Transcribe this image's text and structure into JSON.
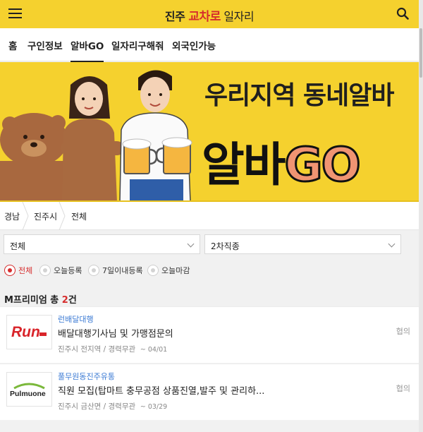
{
  "header": {
    "brand_part1": "진주 ",
    "brand_part2": "교차로",
    "brand_part3": " 일자리"
  },
  "tabs": [
    {
      "label": "홈"
    },
    {
      "label": "구인정보"
    },
    {
      "label": "알바GO",
      "active": true
    },
    {
      "label": "일자리구해줘"
    },
    {
      "label": "외국인가능"
    }
  ],
  "banner": {
    "slogan": "우리지역 동네알바",
    "big_prefix": "알바",
    "big_go": "GO"
  },
  "breadcrumb": [
    "경남",
    "진주시",
    "전체"
  ],
  "filters": {
    "category_select": "전체",
    "subcategory_select": "2차직종",
    "radios": [
      {
        "label": "전체",
        "checked": true
      },
      {
        "label": "오늘등록",
        "checked": false
      },
      {
        "label": "7일이내등록",
        "checked": false
      },
      {
        "label": "오늘마감",
        "checked": false
      }
    ]
  },
  "premium": {
    "prefix": "M프리미엄 총 ",
    "count": "2",
    "suffix": "건"
  },
  "jobs": [
    {
      "logo_text": "Run",
      "company": "런배달대행",
      "title": "배달대행기사님 및 가맹점문의",
      "location": "진주시 전지역 / 경력무관",
      "date": "~ 04/01",
      "pay": "협의"
    },
    {
      "logo_text": "Pulmuone",
      "company": "풀무원동진주유통",
      "title": "직원 모집(탑마트 충무공점 상품진열,발주 및 관리하...",
      "location": "진주시 금산면 / 경력무관",
      "date": "~ 03/29",
      "pay": "협의"
    }
  ],
  "colors": {
    "accent_yellow": "#f5d12e",
    "accent_red": "#d62d2d",
    "link_blue": "#3c7bd4"
  }
}
